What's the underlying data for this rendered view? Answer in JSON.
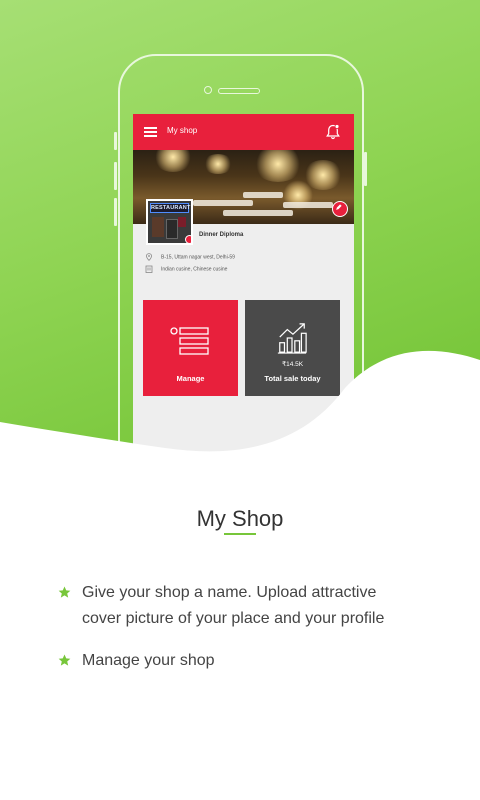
{
  "app_screen": {
    "title": "My shop",
    "shop_name": "Dinner Diploma",
    "address": "B-15, Uttam nagar west, Delhi-59",
    "cuisine": "Indian cusine, Chinese cusine",
    "cover_sign_text": "RESTAURANT",
    "tiles": [
      {
        "label": "Manage",
        "value": ""
      },
      {
        "label": "Total sale today",
        "value": "₹14.5K"
      }
    ]
  },
  "content": {
    "title": "My Shop",
    "bullets": [
      "Give your shop a name. Upload attractive cover picture of your place and your profile",
      "Manage your shop"
    ]
  },
  "colors": {
    "brand_red": "#e8203c",
    "accent_green": "#77c63a",
    "tile_dark": "#4a4a4a"
  },
  "icons": [
    "menu-icon",
    "bell-icon",
    "edit-icon",
    "camera-icon",
    "location-pin-icon",
    "food-icon",
    "manage-list-icon",
    "sales-chart-icon",
    "star-icon"
  ]
}
